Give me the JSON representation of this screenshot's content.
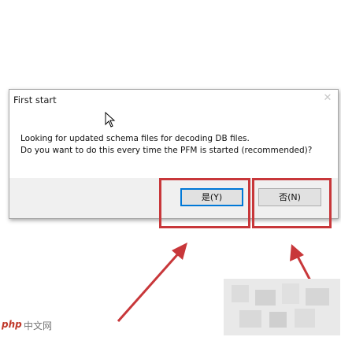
{
  "dialog": {
    "title": "First start",
    "close_glyph": "✕",
    "message_line1": "Looking for updated schema files for decoding DB files.",
    "message_line2": "Do you want to do this every time the PFM is started (recommended)?"
  },
  "buttons": {
    "yes_label": "是(Y)",
    "no_label": "否(N)"
  },
  "annotations": {
    "highlight_color": "#c8373a"
  },
  "watermark": {
    "logo": "php",
    "text": "中文网"
  },
  "icons": {
    "cursor": "mouse-pointer-icon",
    "close": "close-icon",
    "arrow": "red-arrow-icon"
  }
}
